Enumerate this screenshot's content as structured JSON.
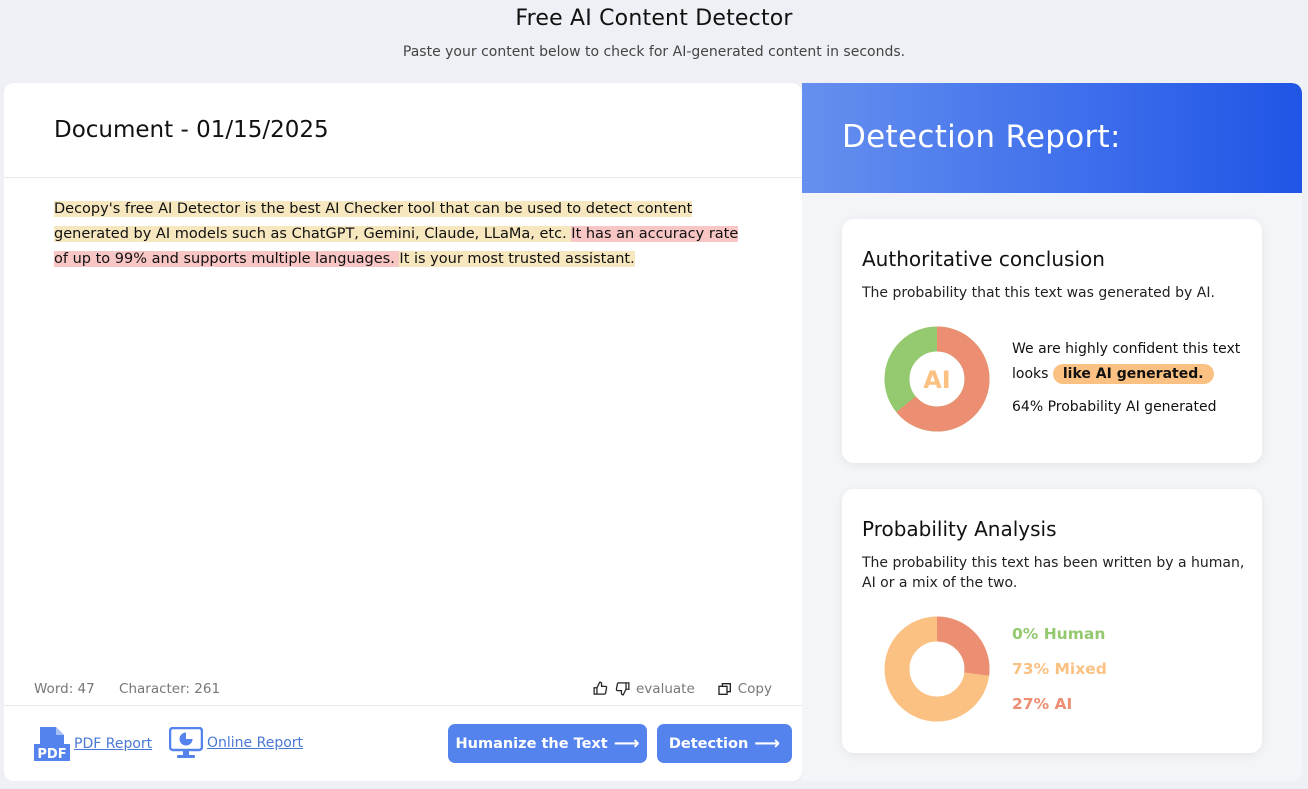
{
  "header": {
    "title": "Free AI Content Detector",
    "subtitle": "Paste your content below to check for AI-generated content in seconds."
  },
  "document": {
    "title": "Document - 01/15/2025",
    "segments": [
      {
        "text": "Decopy's free AI Detector is the best AI Checker tool that can be used to detect content generated by AI models such as ChatGPT, Gemini, Claude, LLaMa, etc. ",
        "highlight": "yellow"
      },
      {
        "text": "It has an accuracy rate of up to 99% and supports multiple languages. ",
        "highlight": "red"
      },
      {
        "text": "It is your most trusted assistant.",
        "highlight": "yellow"
      }
    ],
    "word_count": "Word: 47",
    "char_count": "Character: 261",
    "evaluate_label": "evaluate",
    "copy_label": "Copy"
  },
  "footer": {
    "pdf_report_label": "PDF Report",
    "pdf_icon_text": "PDF",
    "online_report_label": "Online Report",
    "humanize_label": "Humanize the Text",
    "detection_label": "Detection",
    "arrow": "⟶"
  },
  "report": {
    "title": "Detection Report:",
    "conclusion": {
      "title": "Authoritative conclusion",
      "description": "The probability that this text was generated by AI.",
      "donut_label": "AI",
      "confidence_text": "We are highly confident this text looks",
      "badge": "like AI generated.",
      "probability_text": "64% Probability AI generated",
      "ai_fraction": 0.64
    },
    "analysis": {
      "title": "Probability Analysis",
      "description": "The probability this text has been written by a human, AI or a mix of the two.",
      "human_label": "0% Human",
      "mixed_label": "73% Mixed",
      "ai_label": "27% AI",
      "human_fraction": 0.0,
      "mixed_fraction": 0.73,
      "ai_fraction": 0.27
    }
  },
  "colors": {
    "accent_blue": "#5583ee",
    "link_blue": "#4a78d6",
    "ai_red": "#eb8e72",
    "human_green": "#94c96f",
    "mixed_orange": "#fbc183",
    "highlight_yellow": "#f6e7bf",
    "highlight_red": "#f9c6c6"
  }
}
